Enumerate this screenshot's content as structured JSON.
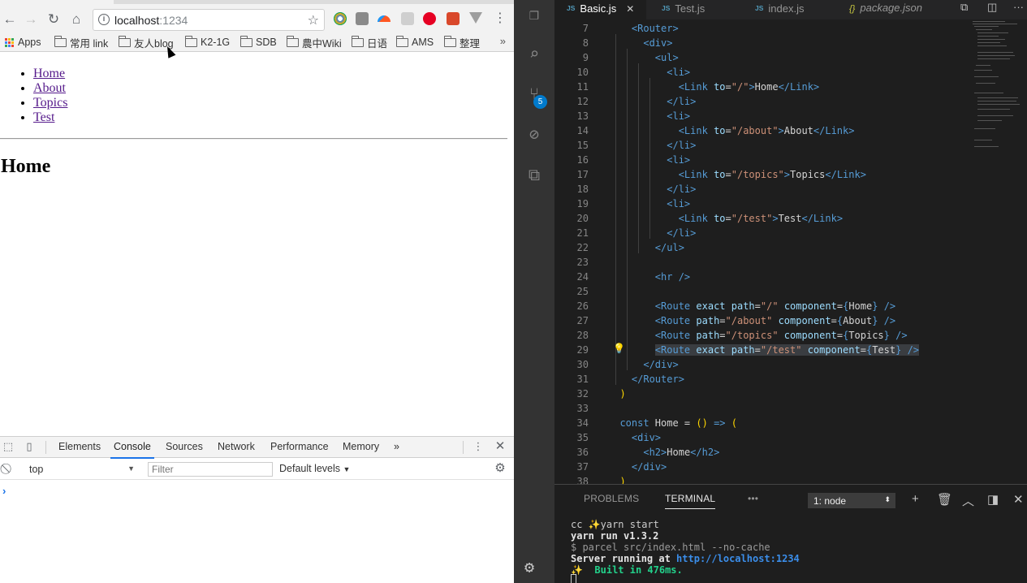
{
  "browser": {
    "url_host": "localhost",
    "url_port": ":1234",
    "bookmarks": [
      {
        "label": "Apps"
      },
      {
        "label": "常用 link"
      },
      {
        "label": "友人blog"
      },
      {
        "label": "K2-1G"
      },
      {
        "label": "SDB"
      },
      {
        "label": "農中Wiki"
      },
      {
        "label": "日语"
      },
      {
        "label": "AMS"
      },
      {
        "label": "整理"
      }
    ],
    "bookmarks_more": "»",
    "page": {
      "links": [
        "Home",
        "About",
        "Topics",
        "Test"
      ],
      "heading": "Home"
    },
    "devtools": {
      "tabs": [
        "Elements",
        "Console",
        "Sources",
        "Network",
        "Performance",
        "Memory"
      ],
      "more": "»",
      "active_tab": "Console",
      "context": "top",
      "filter_placeholder": "Filter",
      "levels": "Default levels",
      "prompt": "›"
    }
  },
  "vscode": {
    "tabs": [
      {
        "label": "Basic.js",
        "kind": "JS",
        "active": true
      },
      {
        "label": "Test.js",
        "kind": "JS",
        "active": false
      },
      {
        "label": "index.js",
        "kind": "JS",
        "active": false
      },
      {
        "label": "package.json",
        "kind": "{}",
        "active": false
      }
    ],
    "scm_badge": "5",
    "code_lines": [
      {
        "n": "7"
      },
      {
        "n": "8"
      },
      {
        "n": "9"
      },
      {
        "n": "10"
      },
      {
        "n": "11"
      },
      {
        "n": "12"
      },
      {
        "n": "13"
      },
      {
        "n": "14"
      },
      {
        "n": "15"
      },
      {
        "n": "16"
      },
      {
        "n": "17"
      },
      {
        "n": "18"
      },
      {
        "n": "19"
      },
      {
        "n": "20"
      },
      {
        "n": "21"
      },
      {
        "n": "22"
      },
      {
        "n": "23"
      },
      {
        "n": "24"
      },
      {
        "n": "25"
      },
      {
        "n": "26"
      },
      {
        "n": "27"
      },
      {
        "n": "28"
      },
      {
        "n": "29"
      },
      {
        "n": "30"
      },
      {
        "n": "31"
      },
      {
        "n": "32"
      },
      {
        "n": "33"
      },
      {
        "n": "34"
      },
      {
        "n": "35"
      },
      {
        "n": "36"
      },
      {
        "n": "37"
      },
      {
        "n": "38"
      }
    ],
    "panel": {
      "tabs": [
        "PROBLEMS",
        "TERMINAL"
      ],
      "active_tab": "TERMINAL",
      "more": "•••",
      "terminal_select": "1: node"
    },
    "terminal": {
      "l1": "cc ✨yarn start",
      "l2": "yarn run v1.3.2",
      "l3": "$ parcel src/index.html --no-cache",
      "l4_prefix": "Server running at ",
      "l4_link": "http://localhost:1234",
      "l5": "✨  Built in 476ms."
    }
  },
  "colors": {
    "vscode_bg": "#1e1e1e",
    "activity_bar": "#333333",
    "accent_blue": "#007acc",
    "tag_blue": "#569cd6",
    "string_orange": "#ce9178",
    "link_purple": "#551a8b"
  }
}
